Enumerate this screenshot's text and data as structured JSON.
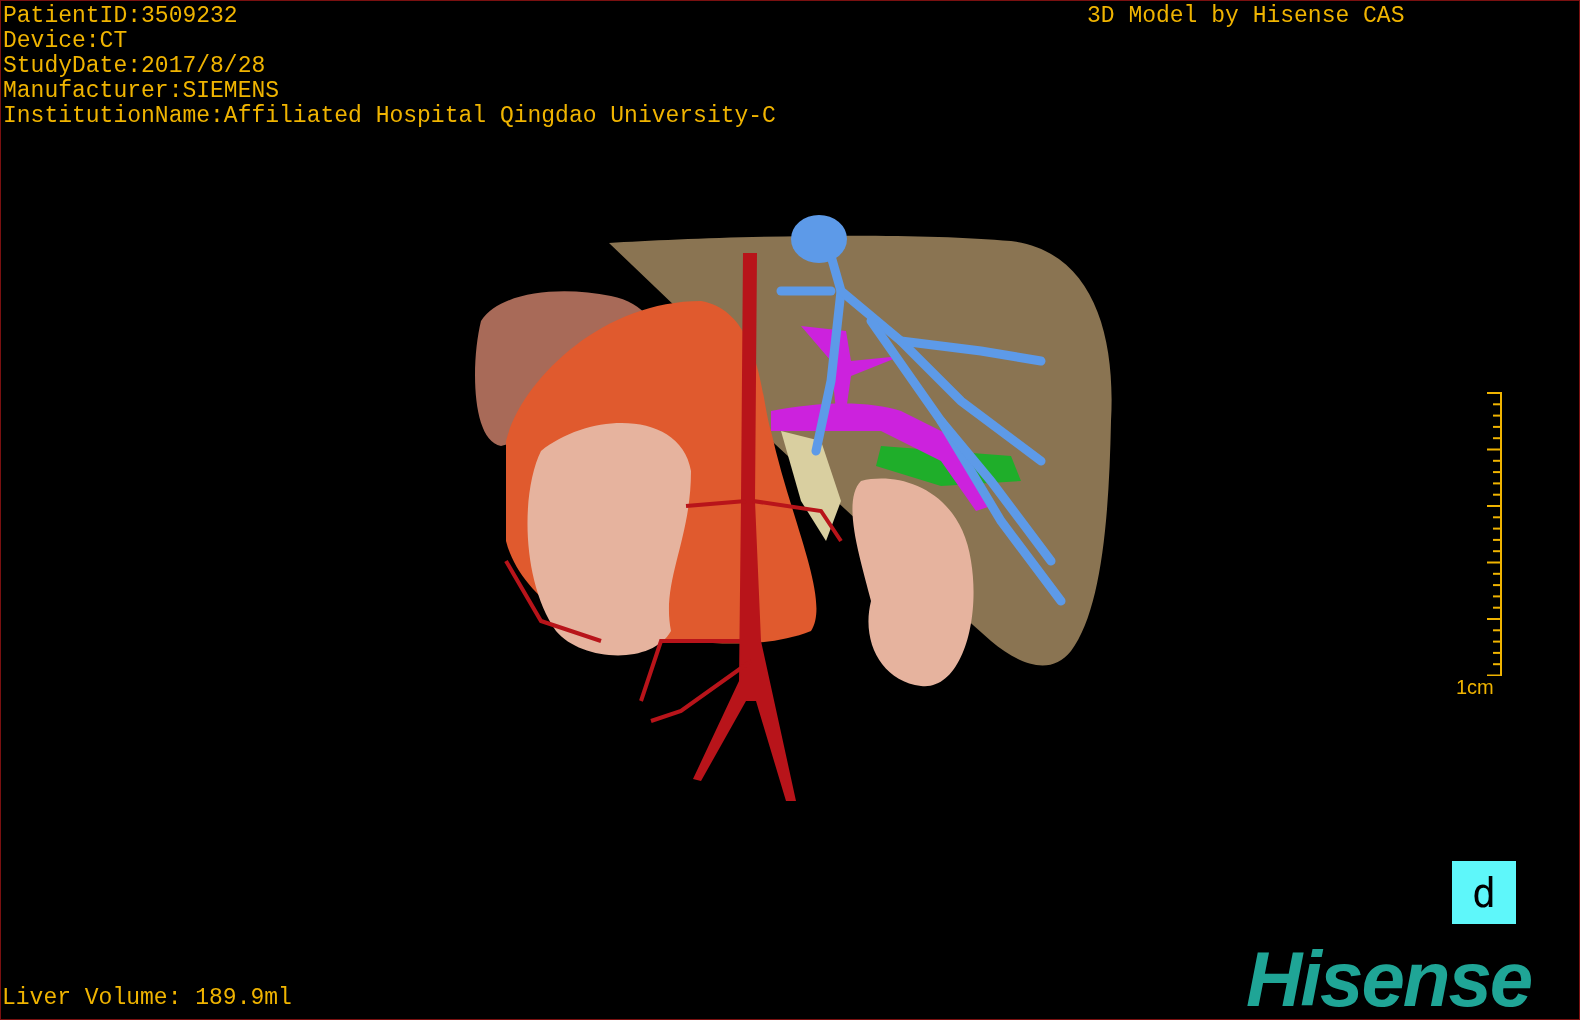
{
  "patient_info": [
    "PatientID:3509232",
    "Device:CT",
    "StudyDate:2017/8/28",
    "Manufacturer:SIEMENS",
    "InstitutionName:Affiliated Hospital Qingdao University-C"
  ],
  "header_right": "3D Model by Hisense CAS",
  "scale_bar": {
    "label": "1cm"
  },
  "orientation_marker": {
    "label": "d"
  },
  "logo": "Hisense",
  "measurement": "Liver Volume: 189.9ml"
}
